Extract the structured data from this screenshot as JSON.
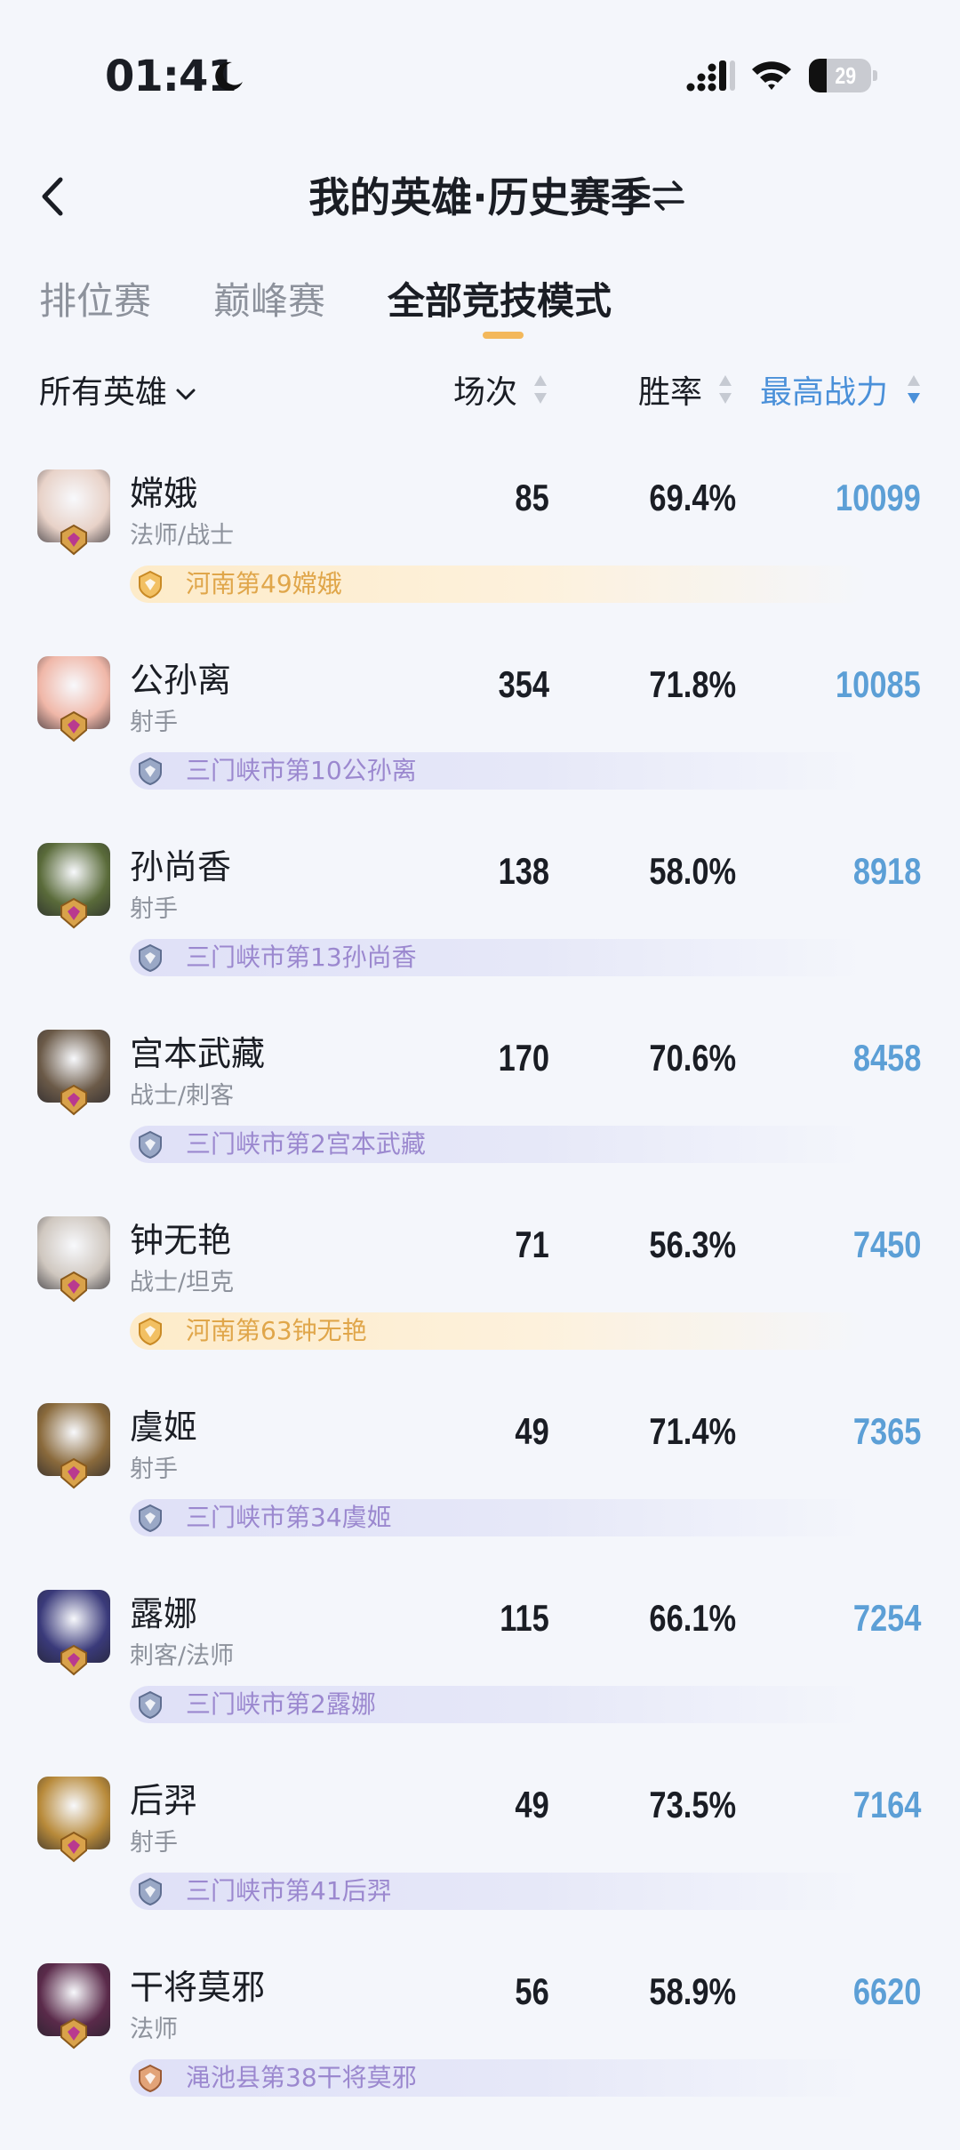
{
  "status_bar": {
    "time": "01:41",
    "battery": "29",
    "battery_level": 0.29
  },
  "header": {
    "title": "我的英雄·历史赛季"
  },
  "tabs": [
    {
      "label": "排位赛",
      "active": false
    },
    {
      "label": "巅峰赛",
      "active": false
    },
    {
      "label": "全部竞技模式",
      "active": true
    }
  ],
  "columns": {
    "filter": "所有英雄",
    "games": "场次",
    "win_rate": "胜率",
    "max_power": "最高战力"
  },
  "colors": {
    "accent": "#4a90d9",
    "indicator": "#f3b85b",
    "gold_badge": "#e0a64a",
    "purple_badge": "#9b88cf"
  },
  "heroes": [
    {
      "name": "嫦娥",
      "role": "法师/战士",
      "games": "85",
      "win_rate": "69.4%",
      "power": "10099",
      "badge_type": "gold",
      "badge": "河南第49嫦娥",
      "avatar_color": "#e8d2c8"
    },
    {
      "name": "公孙离",
      "role": "射手",
      "games": "354",
      "win_rate": "71.8%",
      "power": "10085",
      "badge_type": "purple",
      "badge": "三门峡市第10公孙离",
      "avatar_color": "#f0b7a8"
    },
    {
      "name": "孙尚香",
      "role": "射手",
      "games": "138",
      "win_rate": "58.0%",
      "power": "8918",
      "badge_type": "purple",
      "badge": "三门峡市第13孙尚香",
      "avatar_color": "#5a6b3a"
    },
    {
      "name": "宫本武藏",
      "role": "战士/刺客",
      "games": "170",
      "win_rate": "70.6%",
      "power": "8458",
      "badge_type": "purple",
      "badge": "三门峡市第2宫本武藏",
      "avatar_color": "#6b5a48"
    },
    {
      "name": "钟无艳",
      "role": "战士/坦克",
      "games": "71",
      "win_rate": "56.3%",
      "power": "7450",
      "badge_type": "gold",
      "badge": "河南第63钟无艳",
      "avatar_color": "#cfc7bf"
    },
    {
      "name": "虞姬",
      "role": "射手",
      "games": "49",
      "win_rate": "71.4%",
      "power": "7365",
      "badge_type": "purple",
      "badge": "三门峡市第34虞姬",
      "avatar_color": "#8a6a3c"
    },
    {
      "name": "露娜",
      "role": "刺客/法师",
      "games": "115",
      "win_rate": "66.1%",
      "power": "7254",
      "badge_type": "purple",
      "badge": "三门峡市第2露娜",
      "avatar_color": "#3a3a7a"
    },
    {
      "name": "后羿",
      "role": "射手",
      "games": "49",
      "win_rate": "73.5%",
      "power": "7164",
      "badge_type": "purple",
      "badge": "三门峡市第41后羿",
      "avatar_color": "#b88a3a"
    },
    {
      "name": "干将莫邪",
      "role": "法师",
      "games": "56",
      "win_rate": "58.9%",
      "power": "6620",
      "badge_type": "bronze",
      "badge": "渑池县第38干将莫邪",
      "avatar_color": "#5a2a4a"
    }
  ]
}
